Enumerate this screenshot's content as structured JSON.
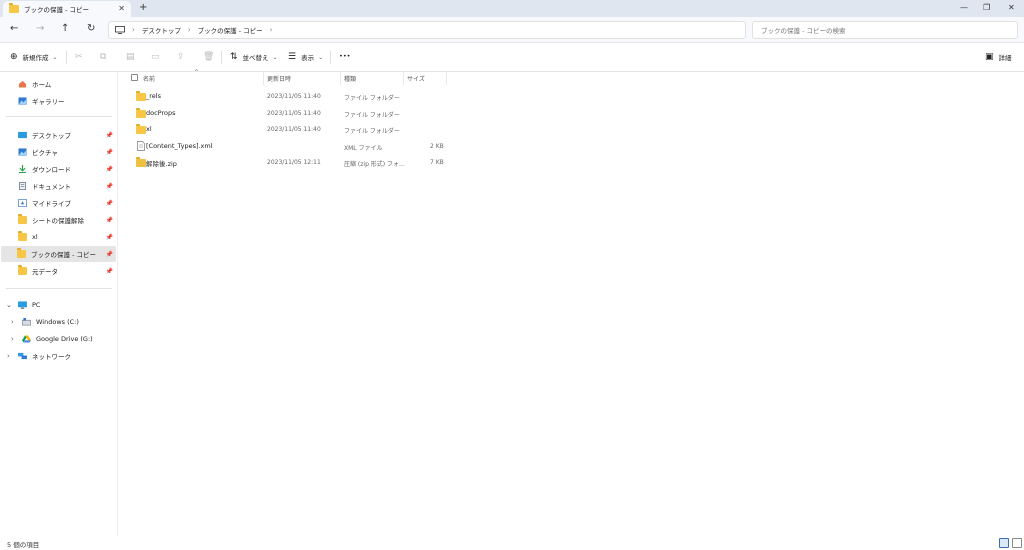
{
  "window": {
    "tab_title": "ブックの保護 - コピー",
    "new_tab_symbol": "+",
    "close_symbol": "✕",
    "minimize_symbol": "—",
    "maximize_symbol": "❐"
  },
  "address": {
    "crumbs": [
      "デスクトップ",
      "ブックの保護 - コピー"
    ],
    "search_placeholder": "ブックの保護 - コピーの検索"
  },
  "commandbar": {
    "new_label": "新規作成",
    "sort_label": "並べ替え",
    "view_label": "表示",
    "more_label": "•••",
    "details_label": "詳細"
  },
  "sidebar": {
    "top": [
      {
        "label": "ホーム",
        "icon": "home-icon"
      },
      {
        "label": "ギャラリー",
        "icon": "gallery-icon"
      }
    ],
    "quick": [
      {
        "label": "デスクトップ",
        "icon": "desktop-icon"
      },
      {
        "label": "ピクチャ",
        "icon": "pictures-icon"
      },
      {
        "label": "ダウンロード",
        "icon": "download-icon"
      },
      {
        "label": "ドキュメント",
        "icon": "documents-icon"
      },
      {
        "label": "マイドライブ",
        "icon": "drive-icon"
      },
      {
        "label": "シートの保護解除",
        "icon": "folder-icon"
      },
      {
        "label": "xl",
        "icon": "folder-icon"
      },
      {
        "label": "ブックの保護 - コピー",
        "icon": "folder-icon"
      },
      {
        "label": "元データ",
        "icon": "folder-icon"
      }
    ],
    "pc": {
      "label": "PC"
    },
    "drives": [
      {
        "label": "Windows (C:)"
      },
      {
        "label": "Google Drive (G:)"
      }
    ],
    "network": {
      "label": "ネットワーク"
    }
  },
  "columns": {
    "name": "名前",
    "date": "更新日時",
    "type": "種類",
    "size": "サイズ"
  },
  "files": [
    {
      "name": "_rels",
      "date": "2023/11/05 11:40",
      "type": "ファイル フォルダー",
      "size": "",
      "kind": "folder"
    },
    {
      "name": "docProps",
      "date": "2023/11/05 11:40",
      "type": "ファイル フォルダー",
      "size": "",
      "kind": "folder"
    },
    {
      "name": "xl",
      "date": "2023/11/05 11:40",
      "type": "ファイル フォルダー",
      "size": "",
      "kind": "folder"
    },
    {
      "name": "[Content_Types].xml",
      "date": "",
      "type": "XML ファイル",
      "size": "2 KB",
      "kind": "xml"
    },
    {
      "name": "解除後.zip",
      "date": "2023/11/05 12:11",
      "type": "圧縮 (zip 形式) フォ...",
      "size": "7 KB",
      "kind": "zip"
    }
  ],
  "status": {
    "item_count": "5 個の項目"
  }
}
